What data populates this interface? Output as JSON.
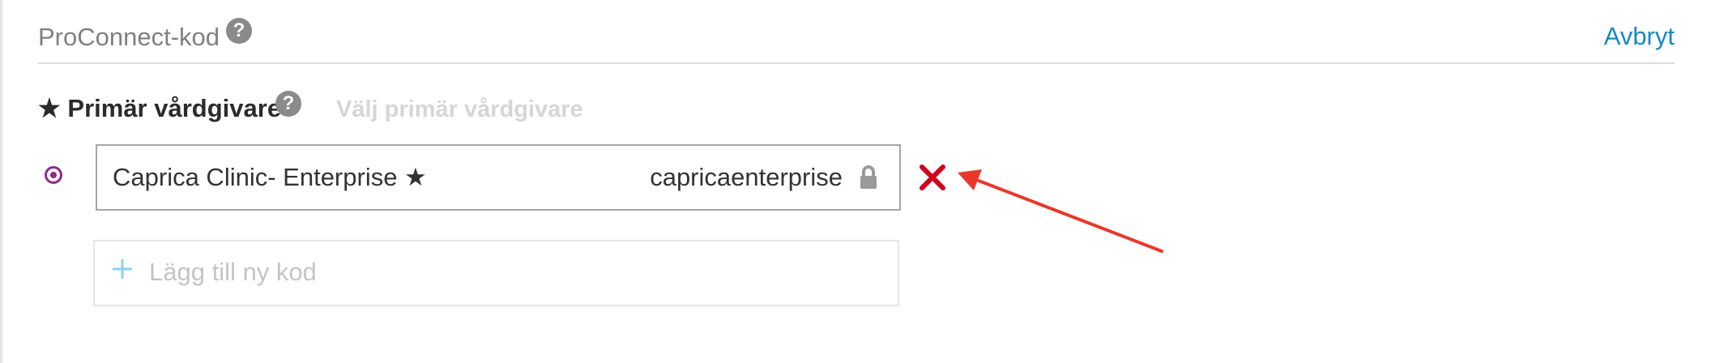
{
  "section": {
    "title": "ProConnect-kod",
    "cancel_label": "Avbryt",
    "help_symbol": "?"
  },
  "primary_provider": {
    "label": "★ Primär vårdgivare",
    "help_symbol": "?",
    "placeholder": "Välj primär vårdgivare"
  },
  "codes": [
    {
      "name": "Caprica Clinic- Enterprise ★",
      "code": "capricaenterprise",
      "selected": true,
      "locked": true
    }
  ],
  "add_code": {
    "label": "Lägg till ny kod"
  },
  "icons": {
    "help": "help-icon",
    "lock": "lock-icon",
    "remove": "close-icon",
    "add": "plus-icon",
    "radio": "radio-selected-icon"
  },
  "colors": {
    "link": "#1a87c9",
    "radio": "#8e2a8e",
    "remove": "#d0021b",
    "annotation_arrow": "#e8382c"
  }
}
